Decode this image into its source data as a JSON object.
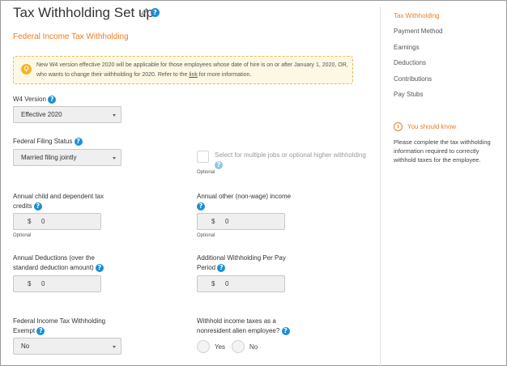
{
  "page": {
    "title": "Tax Withholding Set up",
    "section_heading": "Federal Income Tax Withholding"
  },
  "alert": {
    "text_before_link": "New W4 version effective 2020 will be applicable for those employees whose date of hire is on or after January 1, 2020, OR, who wants to change their withholding for 2020. Refer to the ",
    "link_text": "link",
    "text_after_link": " for more information."
  },
  "form": {
    "w4_version": {
      "label": "W4 Version",
      "value": "Effective 2020"
    },
    "filing_status": {
      "label": "Federal Filing Status",
      "value": "Married filing jointly"
    },
    "multiple_jobs": {
      "label": "Select for multiple jobs or optional higher withholding",
      "optional": "Optional"
    },
    "dependent_credits": {
      "label_line1": "Annual child and dependent tax",
      "label_line2": "credits",
      "currency": "$",
      "value": "0",
      "optional": "Optional"
    },
    "other_income": {
      "label_line1": "Annual other (non-wage) income",
      "currency": "$",
      "value": "0",
      "optional": "Optional"
    },
    "deductions": {
      "label_line1": "Annual Deductions (over the",
      "label_line2": "standard deduction amount)",
      "currency": "$",
      "value": "0"
    },
    "additional_withholding": {
      "label_line1": "Additional Withholding Per Pay",
      "label_line2": "Period",
      "currency": "$",
      "value": "0"
    },
    "exempt": {
      "label_line1": "Federal Income Tax Withholding",
      "label_line2": "Exempt",
      "value": "No"
    },
    "nonresident": {
      "label_line1": "Withhold income taxes as a",
      "label_line2": "nonresident alien employee?",
      "yes": "Yes",
      "no": "No"
    }
  },
  "sidebar": {
    "items": [
      {
        "label": "Tax Withholding",
        "active": true
      },
      {
        "label": "Payment Method",
        "active": false
      },
      {
        "label": "Earnings",
        "active": false
      },
      {
        "label": "Deductions",
        "active": false
      },
      {
        "label": "Contributions",
        "active": false
      },
      {
        "label": "Pay Stubs",
        "active": false
      }
    ],
    "info_title": "You should know",
    "info_text": "Please complete the tax withholding information required to correctly withhold taxes for the employee."
  },
  "colors": {
    "accent": "#f07b1e",
    "help": "#1a8fd6",
    "alert_bg": "#fdf8e4",
    "alert_border": "#e3bd4d"
  },
  "icons": {
    "edit": "pencil-icon",
    "help": "question-circle-icon",
    "alert": "lightbulb-icon",
    "info": "exclamation-circle-icon"
  }
}
